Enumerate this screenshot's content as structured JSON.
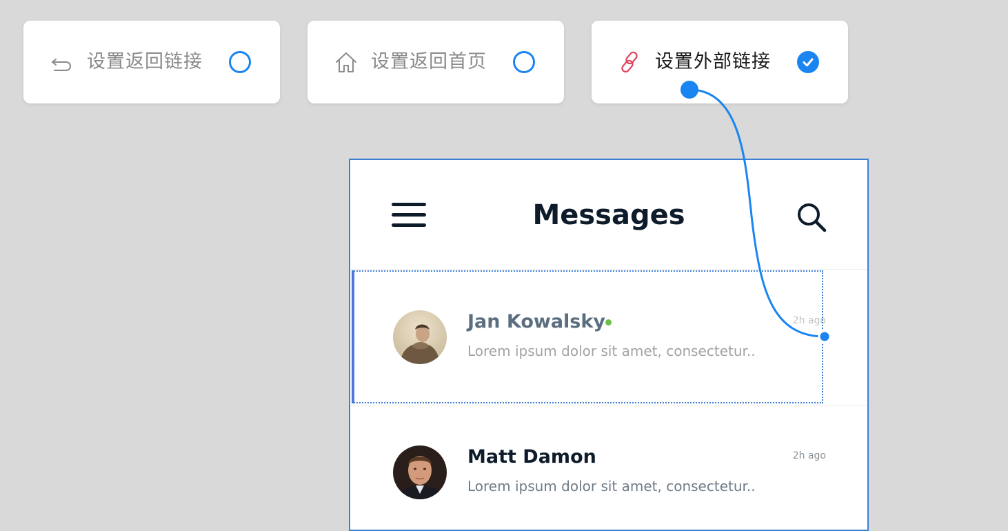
{
  "options": [
    {
      "id": "back",
      "label": "设置返回链接",
      "icon": "back-arrow-icon",
      "selected": false
    },
    {
      "id": "home",
      "label": "设置返回首页",
      "icon": "home-icon",
      "selected": false
    },
    {
      "id": "link",
      "label": "设置外部链接",
      "icon": "link-icon",
      "selected": true
    }
  ],
  "colors": {
    "accent": "#1a84f1",
    "link_icon": "#e0405a",
    "online": "#6cc04a",
    "frame": "#3d7fd4"
  },
  "app": {
    "title": "Messages",
    "menu_icon": "hamburger-menu-icon",
    "search_icon": "search-icon"
  },
  "messages": [
    {
      "name": "Jan Kowalsky",
      "online": true,
      "preview": "Lorem ipsum dolor sit amet, consectetur..",
      "time": "2h ago",
      "selected": true
    },
    {
      "name": "Matt Damon",
      "online": false,
      "preview": "Lorem ipsum dolor sit amet, consectetur..",
      "time": "2h ago",
      "selected": false
    }
  ]
}
